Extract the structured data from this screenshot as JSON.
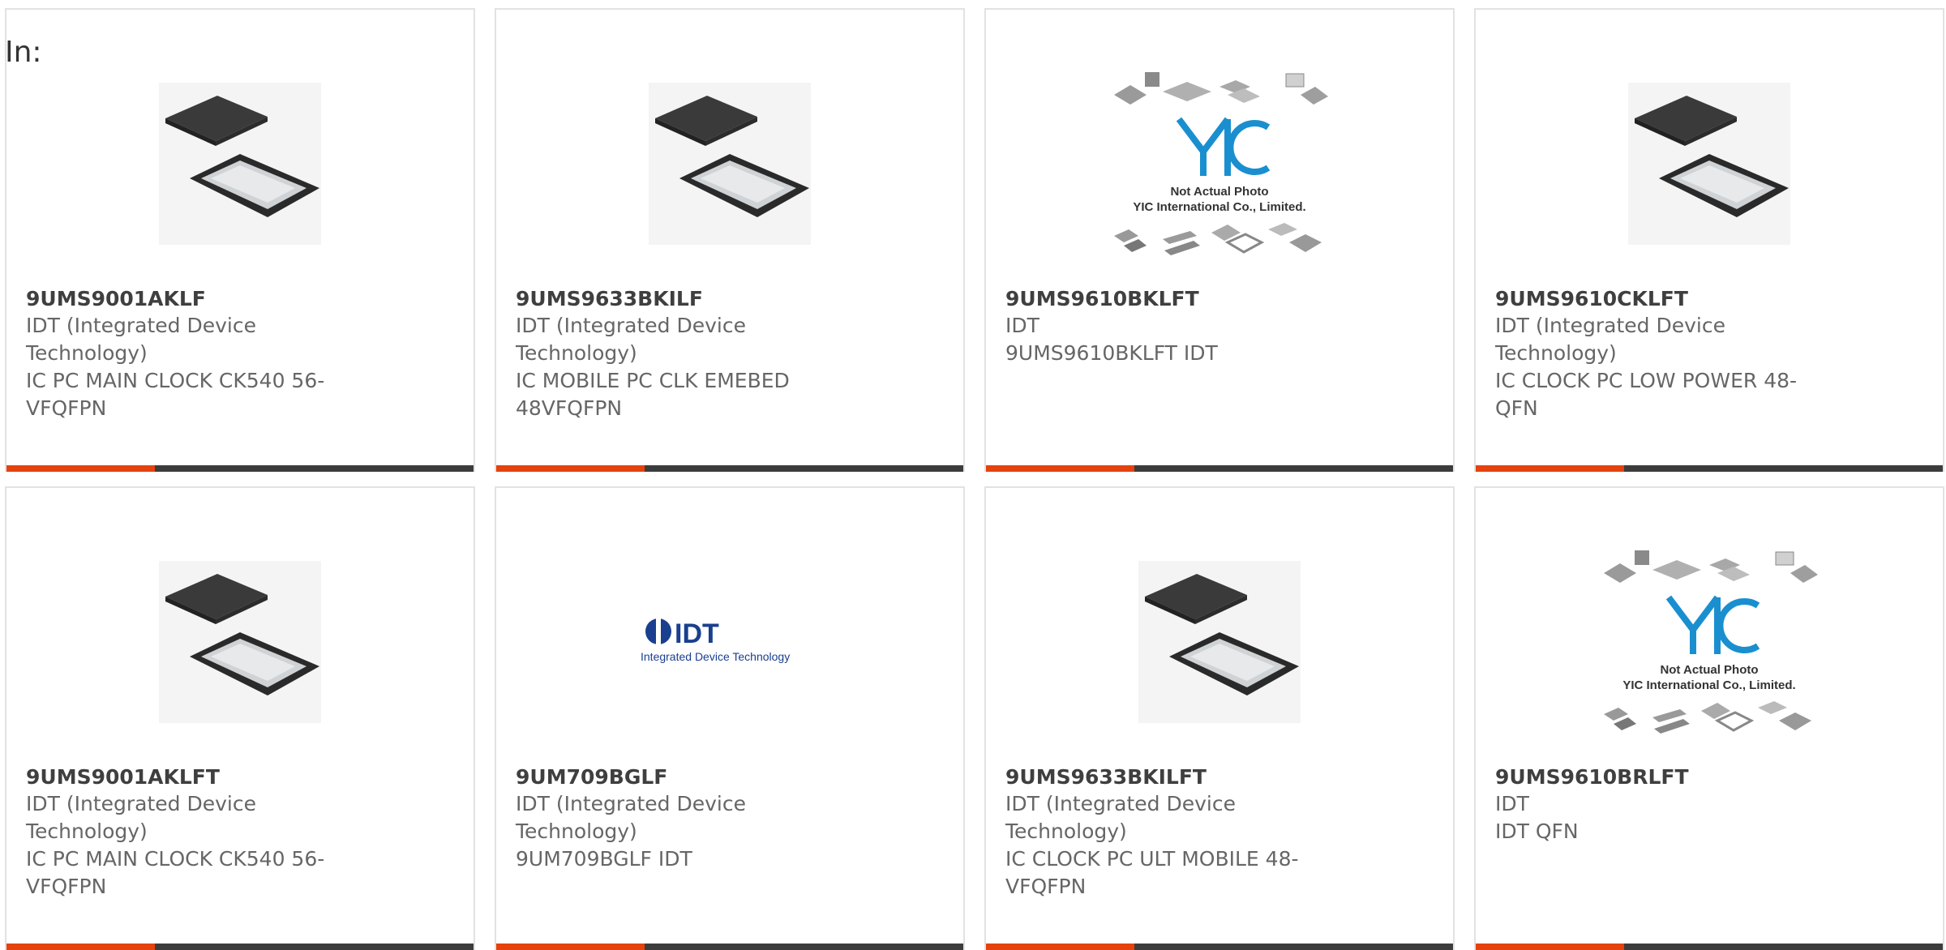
{
  "filter_label": "In:",
  "products": [
    {
      "part": "9UMS9001AKLF",
      "manufacturer": "IDT (Integrated Device Technology)",
      "description": "IC PC MAIN CLOCK CK540 56-VFQFPN",
      "image": "qfn-chip"
    },
    {
      "part": "9UMS9633BKILF",
      "manufacturer": "IDT (Integrated Device Technology)",
      "description": "IC MOBILE PC CLK EMEBED 48VFQFPN",
      "image": "qfn-chip"
    },
    {
      "part": "9UMS9610BKLFT",
      "manufacturer": "IDT",
      "description": "9UMS9610BKLFT IDT",
      "image": "not-actual-photo"
    },
    {
      "part": "9UMS9610CKLFT",
      "manufacturer": "IDT (Integrated Device Technology)",
      "description": "IC CLOCK PC LOW POWER 48-QFN",
      "image": "qfn-chip"
    },
    {
      "part": "9UMS9001AKLFT",
      "manufacturer": "IDT (Integrated Device Technology)",
      "description": "IC PC MAIN CLOCK CK540 56-VFQFPN",
      "image": "qfn-chip"
    },
    {
      "part": "9UM709BGLF",
      "manufacturer": "IDT (Integrated Device Technology)",
      "description": "9UM709BGLF IDT",
      "image": "idt-logo"
    },
    {
      "part": "9UMS9633BKILFT",
      "manufacturer": "IDT (Integrated Device Technology)",
      "description": "IC CLOCK PC ULT MOBILE 48-VFQFPN",
      "image": "qfn-chip"
    },
    {
      "part": "9UMS9610BRLFT",
      "manufacturer": "IDT",
      "description": "IDT QFN",
      "image": "not-actual-photo"
    }
  ],
  "placeholder_caption": {
    "line1": "Not Actual Photo",
    "line2": "YIC International Co., Limited."
  },
  "idt_logo": {
    "word": "IDT",
    "tagline": "Integrated Device Technology"
  },
  "colors": {
    "accent": "#e5420e",
    "bar": "#3c3c3c",
    "logo_blue": "#1a3f8f",
    "yic_blue": "#1a8fd0"
  }
}
